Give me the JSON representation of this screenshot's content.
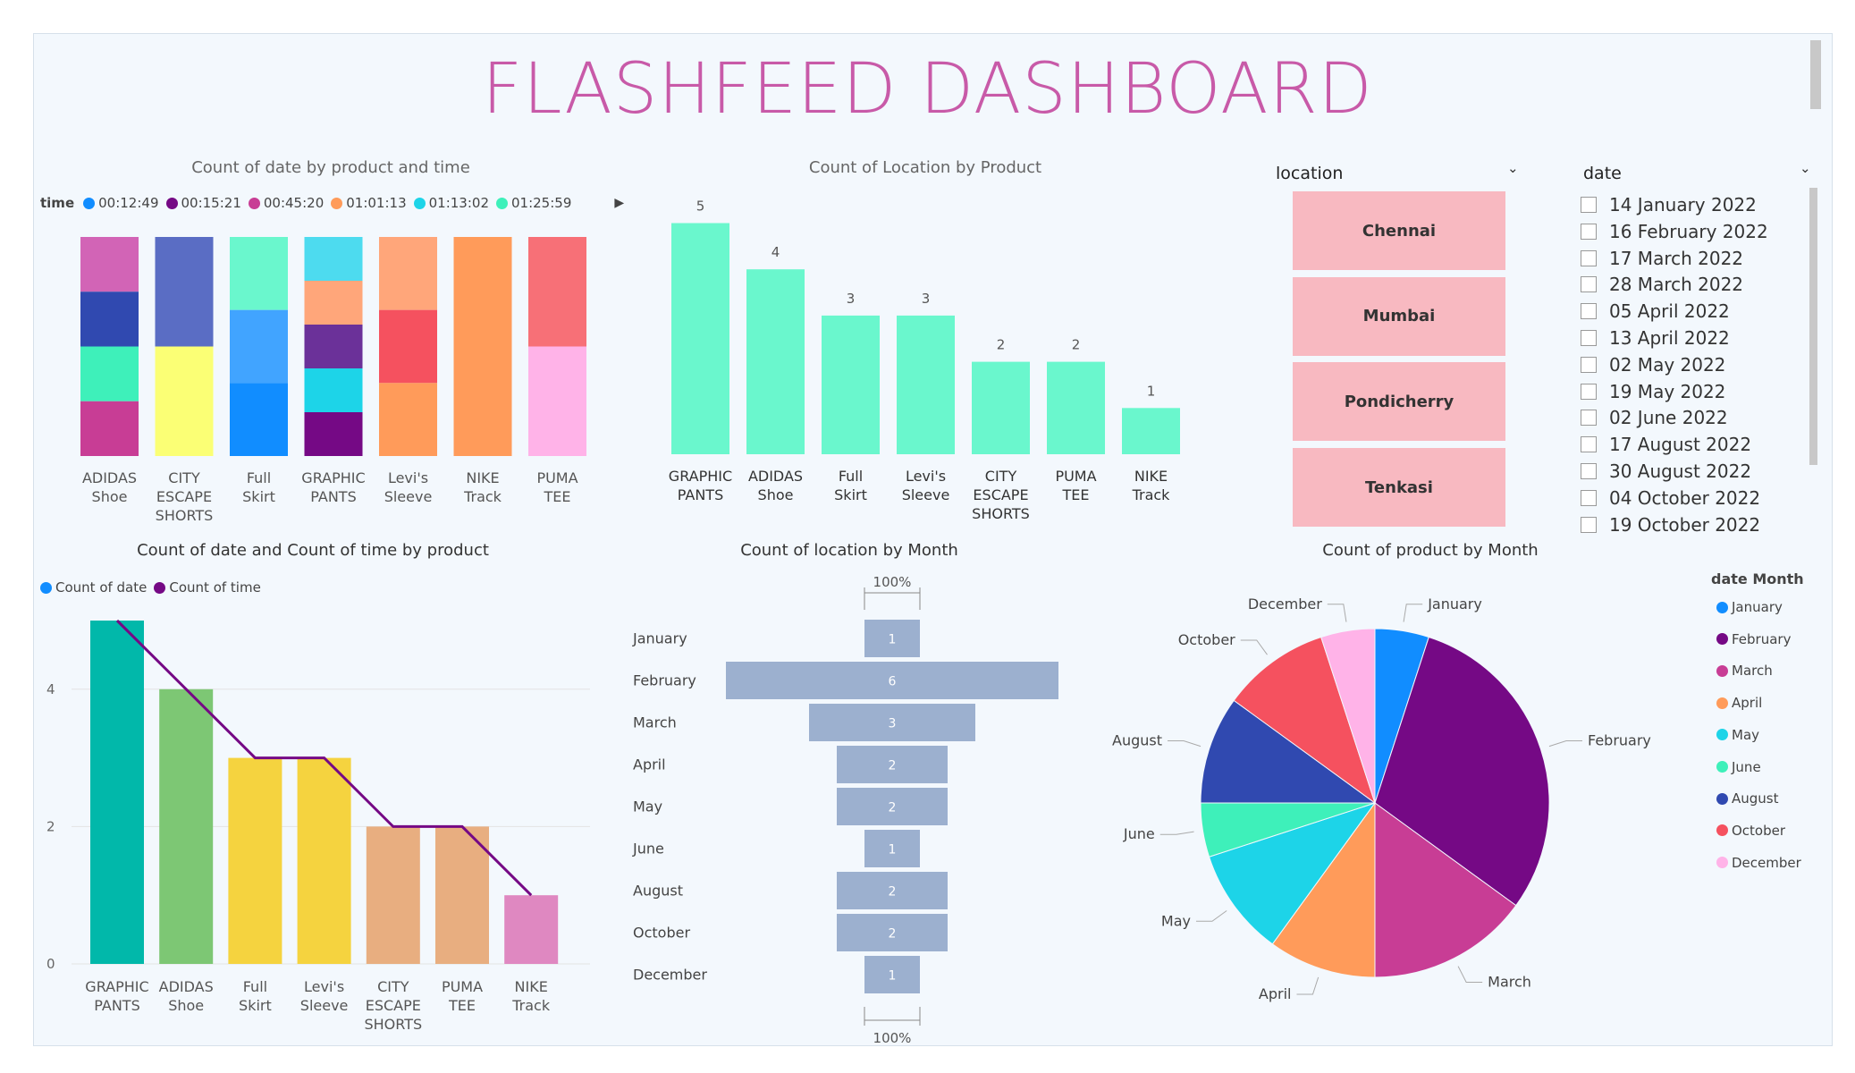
{
  "page": {
    "title": "FLASHFEED DASHBOARD"
  },
  "colors": {
    "t1": "#118dff",
    "t2": "#750985",
    "t3": "#c83d95",
    "t4": "#ff9b5a",
    "t5": "#1dd4e8",
    "t6": "#3ef0ba",
    "mint": "#6af7cd",
    "pink_tile": "#f8b9c1",
    "funnel": "#9cb0cf",
    "line": "#750985",
    "title": "#c85aa8"
  },
  "chart1": {
    "title": "Count of date by product and time",
    "legend_title": "time",
    "legend_items": [
      {
        "label": "00:12:49",
        "color": "#118dff"
      },
      {
        "label": "00:15:21",
        "color": "#750985"
      },
      {
        "label": "00:45:20",
        "color": "#c83d95"
      },
      {
        "label": "01:01:13",
        "color": "#ff9b5a"
      },
      {
        "label": "01:13:02",
        "color": "#1dd4e8"
      },
      {
        "label": "01:25:59",
        "color": "#3ef0ba"
      }
    ]
  },
  "chart2": {
    "title": "Count of Location by Product"
  },
  "chart3": {
    "title": "Count of date and Count of time by product",
    "legend_items": [
      {
        "label": "Count of date",
        "color": "#118dff"
      },
      {
        "label": "Count of time",
        "color": "#750985"
      }
    ]
  },
  "chart4": {
    "title": "Count of location by Month",
    "top_label": "100%",
    "bottom_label": "100%"
  },
  "chart5": {
    "title": "Count of product by Month",
    "legend_title": "date Month",
    "legend_items": [
      {
        "label": "January",
        "color": "#118dff"
      },
      {
        "label": "February",
        "color": "#750985"
      },
      {
        "label": "March",
        "color": "#c83d95"
      },
      {
        "label": "April",
        "color": "#ff9b5a"
      },
      {
        "label": "May",
        "color": "#1dd4e8"
      },
      {
        "label": "June",
        "color": "#3ef0ba"
      },
      {
        "label": "August",
        "color": "#3049b0"
      },
      {
        "label": "October",
        "color": "#f5515f"
      },
      {
        "label": "December",
        "color": "#ffb3e8"
      }
    ]
  },
  "location_slicer": {
    "header": "location",
    "items": [
      "Chennai",
      "Mumbai",
      "Pondicherry",
      "Tenkasi"
    ]
  },
  "date_slicer": {
    "header": "date",
    "items": [
      "14 January 2022",
      "16 February 2022",
      "17 March 2022",
      "28 March 2022",
      "05 April 2022",
      "13 April 2022",
      "02 May 2022",
      "19 May 2022",
      "02 June 2022",
      "17 August 2022",
      "30 August 2022",
      "04 October 2022",
      "19 October 2022"
    ]
  },
  "chart_data": [
    {
      "type": "bar",
      "title": "Count of date by product and time",
      "stacked": "100%",
      "legend_title": "time",
      "legend_placement": "top-left",
      "categories": [
        "ADIDAS Shoe",
        "CITY ESCAPE SHORTS",
        "Full Skirt",
        "GRAPHIC PANTS",
        "Levi's Sleeve",
        "NIKE Track",
        "PUMA TEE"
      ],
      "stacks": [
        {
          "category": "ADIDAS Shoe",
          "segments": [
            {
              "color": "#d264b6",
              "value": 1
            },
            {
              "color": "#3049b0",
              "value": 1
            },
            {
              "color": "#3ef0ba",
              "value": 1
            },
            {
              "color": "#c83d95",
              "value": 1
            }
          ]
        },
        {
          "category": "CITY ESCAPE SHORTS",
          "segments": [
            {
              "color": "#5a6dc4",
              "value": 1
            },
            {
              "color": "#fbff75",
              "value": 1
            }
          ]
        },
        {
          "category": "Full Skirt",
          "segments": [
            {
              "color": "#6af7cd",
              "value": 1
            },
            {
              "color": "#41a4ff",
              "value": 1
            },
            {
              "color": "#118dff",
              "value": 1
            }
          ]
        },
        {
          "category": "GRAPHIC PANTS",
          "segments": [
            {
              "color": "#4ddbef",
              "value": 1
            },
            {
              "color": "#ffa67a",
              "value": 1
            },
            {
              "color": "#6b3199",
              "value": 1
            },
            {
              "color": "#1dd4e8",
              "value": 1
            },
            {
              "color": "#750985",
              "value": 1
            }
          ]
        },
        {
          "category": "Levi's Sleeve",
          "segments": [
            {
              "color": "#ffa67a",
              "value": 1
            },
            {
              "color": "#f5515f",
              "value": 1
            },
            {
              "color": "#ff9b5a",
              "value": 1
            }
          ]
        },
        {
          "category": "NIKE Track",
          "segments": [
            {
              "color": "#ff9b5a",
              "value": 1
            }
          ]
        },
        {
          "category": "PUMA TEE",
          "segments": [
            {
              "color": "#f77077",
              "value": 1
            },
            {
              "color": "#ffb3e8",
              "value": 1
            }
          ]
        }
      ]
    },
    {
      "type": "bar",
      "title": "Count of Location by Product",
      "categories": [
        "GRAPHIC PANTS",
        "ADIDAS Shoe",
        "Full Skirt",
        "Levi's Sleeve",
        "CITY ESCAPE SHORTS",
        "PUMA TEE",
        "NIKE Track"
      ],
      "values": [
        5,
        4,
        3,
        3,
        2,
        2,
        1
      ],
      "data_labels": true
    },
    {
      "type": "bar",
      "title": "Count of date and Count of time by product",
      "categories": [
        "GRAPHIC PANTS",
        "ADIDAS Shoe",
        "Full Skirt",
        "Levi's Sleeve",
        "CITY ESCAPE SHORTS",
        "PUMA TEE",
        "NIKE Track"
      ],
      "series": [
        {
          "name": "Count of date",
          "type": "bar",
          "values": [
            5,
            4,
            3,
            3,
            2,
            2,
            1
          ],
          "colors": [
            "#01b8aa",
            "#7dc774",
            "#f5d33f",
            "#f5d33f",
            "#e8ae80",
            "#e8ae80",
            "#df88c1"
          ]
        },
        {
          "name": "Count of time",
          "type": "line",
          "values": [
            5,
            4,
            3,
            3,
            2,
            2,
            1
          ],
          "color": "#750985"
        }
      ],
      "yticks": [
        0,
        2,
        4
      ],
      "ylim": [
        0,
        5
      ],
      "grid": true,
      "legend_placement": "top-left"
    },
    {
      "type": "bar",
      "subtype": "funnel",
      "title": "Count of location by Month",
      "categories": [
        "January",
        "February",
        "March",
        "April",
        "May",
        "June",
        "August",
        "October",
        "December"
      ],
      "values": [
        1,
        6,
        3,
        2,
        2,
        1,
        2,
        2,
        1
      ],
      "top_label": "100%",
      "bottom_label": "100%"
    },
    {
      "type": "pie",
      "title": "Count of product by Month",
      "legend_title": "date Month",
      "legend_placement": "right",
      "categories": [
        "January",
        "February",
        "March",
        "April",
        "May",
        "June",
        "August",
        "October",
        "December"
      ],
      "values": [
        1,
        6,
        3,
        2,
        2,
        1,
        2,
        2,
        1
      ],
      "colors": [
        "#118dff",
        "#750985",
        "#c83d95",
        "#ff9b5a",
        "#1dd4e8",
        "#3ef0ba",
        "#3049b0",
        "#f5515f",
        "#ffb3e8"
      ]
    }
  ]
}
